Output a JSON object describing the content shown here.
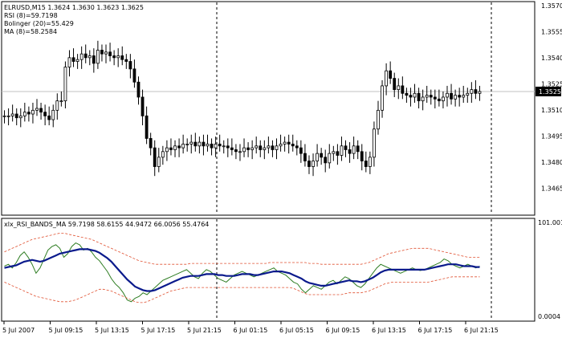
{
  "window": {
    "symbol_line": "ELRUSD,M15  1.3624 1.3630 1.3623 1.3625",
    "indicator_lines": [
      "RSI (8)=59.7198",
      "Bolinger (20)=55.429",
      "MA (8)=58.2584"
    ],
    "sub_title": "xlx_RSI_BANDS_MA 59.7198 58.6155 44.9472 66.0056 55.4764"
  },
  "colors": {
    "background": "#ffffff",
    "candles": "#000000",
    "rsi_line": "#2e7d22",
    "ma_line": "#0a1a8c",
    "bands": "#e05030",
    "separator": "#000000",
    "price_line": "#c0c0c0"
  },
  "chart_data": [
    {
      "type": "candlestick",
      "title": "ELRUSD,M15",
      "ylim": [
        1.3558,
        1.357
      ],
      "y_tick_labels": [
        "1.3570",
        "1.3555",
        "1.3540",
        "1.3525",
        "1.3510",
        "1.3495",
        "1.3480",
        "1.3465"
      ],
      "y_ticks": [
        1.357,
        1.3555,
        1.354,
        1.3525,
        1.351,
        1.3495,
        1.348,
        1.3465
      ],
      "current_price": 1.3525,
      "current_price_label": "1.3525",
      "close": [
        1.3512,
        1.3512,
        1.3513,
        1.3511,
        1.3512,
        1.3514,
        1.3513,
        1.3515,
        1.3516,
        1.3514,
        1.3512,
        1.351,
        1.3515,
        1.352,
        1.352,
        1.3538,
        1.3543,
        1.3541,
        1.3542,
        1.3545,
        1.3543,
        1.3544,
        1.354,
        1.3547,
        1.3545,
        1.3546,
        1.3544,
        1.3543,
        1.3544,
        1.3542,
        1.3541,
        1.3537,
        1.353,
        1.3522,
        1.3512,
        1.35,
        1.3495,
        1.3485,
        1.349,
        1.3493,
        1.3495,
        1.3494,
        1.3496,
        1.3495,
        1.3497,
        1.3497,
        1.3498,
        1.3496,
        1.3498,
        1.3496,
        1.3497,
        1.3495,
        1.3497,
        1.3496,
        1.3496,
        1.3495,
        1.3494,
        1.3493,
        1.3493,
        1.3495,
        1.3494,
        1.3495,
        1.3496,
        1.3494,
        1.3495,
        1.3496,
        1.3494,
        1.3496,
        1.3497,
        1.3498,
        1.3497,
        1.3496,
        1.3495,
        1.3492,
        1.3488,
        1.3485,
        1.3488,
        1.3492,
        1.349,
        1.3487,
        1.3492,
        1.3493,
        1.3491,
        1.3496,
        1.3494,
        1.3492,
        1.3496,
        1.3493,
        1.3488,
        1.3485,
        1.349,
        1.3505,
        1.3515,
        1.3528,
        1.3536,
        1.3532,
        1.3526,
        1.3528,
        1.3524,
        1.3523,
        1.3522,
        1.3524,
        1.352,
        1.3522,
        1.3523,
        1.3522,
        1.3521,
        1.352,
        1.3522,
        1.3524,
        1.3521,
        1.3523,
        1.3522,
        1.3523,
        1.3524,
        1.3526,
        1.3524,
        1.3525
      ],
      "highs": {
        "peak": 1.3548,
        "spike_high": 1.3562
      },
      "x_tick_labels": [
        "5 Jul 2007",
        "5 Jul 09:15",
        "5 Jul 13:15",
        "5 Jul 17:15",
        "5 Jul 21:15",
        "6 Jul 01:15",
        "6 Jul 05:15",
        "6 Jul 09:15",
        "6 Jul 13:15",
        "6 Jul 17:15",
        "6 Jul 21:15"
      ],
      "separators": [
        "5 Jul 21:15",
        "6 Jul 21:15"
      ]
    },
    {
      "type": "line",
      "title": "xlx_RSI_BANDS_MA",
      "y_tick_labels": [
        "101.0017",
        "0.0004"
      ],
      "ylim": [
        0,
        101
      ],
      "series": [
        {
          "name": "RSI (8)",
          "color": "#2e7d22",
          "values": [
            60,
            62,
            58,
            64,
            72,
            76,
            70,
            62,
            52,
            58,
            68,
            78,
            82,
            84,
            80,
            70,
            74,
            82,
            86,
            84,
            78,
            80,
            76,
            70,
            66,
            60,
            54,
            46,
            40,
            36,
            30,
            22,
            20,
            24,
            26,
            30,
            28,
            32,
            36,
            40,
            44,
            46,
            48,
            50,
            52,
            54,
            56,
            52,
            48,
            46,
            52,
            56,
            54,
            50,
            46,
            44,
            42,
            46,
            50,
            52,
            54,
            52,
            50,
            48,
            50,
            52,
            54,
            56,
            58,
            54,
            52,
            50,
            46,
            42,
            40,
            34,
            30,
            34,
            38,
            36,
            34,
            38,
            42,
            44,
            40,
            44,
            48,
            46,
            42,
            38,
            36,
            40,
            46,
            52,
            58,
            62,
            60,
            58,
            56,
            54,
            52,
            54,
            56,
            58,
            56,
            55,
            56,
            58,
            60,
            62,
            64,
            68,
            66,
            62,
            60,
            58,
            60,
            62,
            60,
            58,
            60
          ]
        },
        {
          "name": "MA (8)",
          "color": "#0a1a8c",
          "values": [
            58,
            59,
            60,
            61,
            63,
            65,
            66,
            67,
            66,
            65,
            66,
            68,
            70,
            72,
            74,
            75,
            76,
            77,
            78,
            79,
            79,
            79,
            78,
            77,
            75,
            72,
            69,
            65,
            60,
            55,
            50,
            45,
            41,
            37,
            35,
            33,
            32,
            32,
            33,
            35,
            37,
            39,
            41,
            43,
            45,
            47,
            48,
            49,
            49,
            49,
            50,
            51,
            51,
            51,
            50,
            50,
            49,
            49,
            49,
            50,
            51,
            51,
            51,
            50,
            50,
            51,
            52,
            53,
            54,
            54,
            54,
            53,
            52,
            50,
            48,
            46,
            43,
            41,
            40,
            39,
            38,
            38,
            39,
            40,
            41,
            42,
            43,
            44,
            43,
            43,
            42,
            43,
            45,
            47,
            50,
            53,
            55,
            56,
            56,
            56,
            56,
            56,
            56,
            56,
            56,
            56,
            56,
            57,
            58,
            59,
            60,
            61,
            62,
            62,
            62,
            61,
            60,
            60,
            60,
            59,
            59
          ]
        },
        {
          "name": "Bands upper",
          "color": "#e05030",
          "values": [
            76,
            78,
            80,
            82,
            84,
            86,
            88,
            90,
            91,
            92,
            93,
            94,
            95,
            96,
            97,
            97,
            96,
            95,
            94,
            93,
            92,
            91,
            90,
            88,
            86,
            84,
            82,
            80,
            78,
            76,
            74,
            72,
            70,
            68,
            66,
            65,
            64,
            63,
            62,
            62,
            62,
            62,
            62,
            62,
            62,
            62,
            62,
            63,
            63,
            63,
            63,
            63,
            63,
            63,
            63,
            63,
            63,
            63,
            63,
            63,
            63,
            63,
            63,
            63,
            63,
            63,
            63,
            64,
            64,
            64,
            64,
            64,
            64,
            64,
            64,
            64,
            64,
            63,
            63,
            63,
            62,
            62,
            62,
            62,
            62,
            62,
            62,
            62,
            62,
            62,
            62,
            63,
            64,
            66,
            68,
            70,
            72,
            74,
            75,
            76,
            77,
            78,
            79,
            80,
            80,
            80,
            80,
            80,
            79,
            78,
            77,
            76,
            75,
            74,
            73,
            72,
            71,
            70,
            70,
            70,
            70
          ]
        },
        {
          "name": "Bands lower",
          "color": "#e05030",
          "values": [
            42,
            40,
            38,
            36,
            34,
            32,
            30,
            28,
            26,
            25,
            24,
            23,
            22,
            21,
            20,
            20,
            20,
            21,
            22,
            24,
            26,
            28,
            30,
            32,
            34,
            34,
            33,
            32,
            30,
            28,
            26,
            24,
            22,
            20,
            19,
            19,
            20,
            22,
            24,
            26,
            28,
            30,
            32,
            33,
            34,
            35,
            36,
            36,
            36,
            36,
            36,
            36,
            36,
            36,
            36,
            36,
            36,
            36,
            36,
            36,
            36,
            36,
            36,
            36,
            36,
            36,
            36,
            36,
            36,
            36,
            36,
            36,
            36,
            35,
            33,
            31,
            29,
            28,
            28,
            28,
            28,
            28,
            28,
            28,
            28,
            28,
            29,
            30,
            30,
            30,
            30,
            31,
            32,
            34,
            36,
            38,
            40,
            41,
            42,
            42,
            42,
            42,
            42,
            42,
            42,
            42,
            42,
            42,
            43,
            44,
            45,
            46,
            47,
            48,
            48,
            48,
            48,
            48,
            48,
            48,
            48
          ]
        }
      ]
    }
  ]
}
